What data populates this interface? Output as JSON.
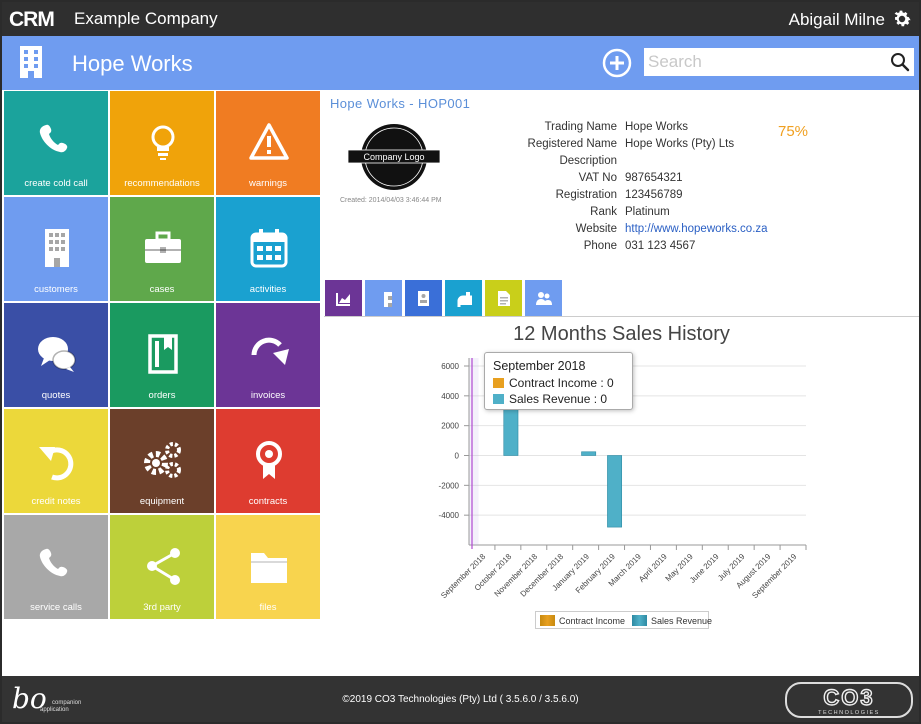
{
  "topbar": {
    "app_logo": "CRM",
    "company": "Example Company",
    "user": "Abigail Milne"
  },
  "header": {
    "title": "Hope Works",
    "search_placeholder": "Search"
  },
  "tiles": [
    {
      "label": "create cold call",
      "icon": "phone-icon",
      "color": "#1ba39c"
    },
    {
      "label": "recommendations",
      "icon": "lightbulb-icon",
      "color": "#f0a30a"
    },
    {
      "label": "warnings",
      "icon": "warning-icon",
      "color": "#f07c22"
    },
    {
      "label": "customers",
      "icon": "building-icon",
      "color": "#6f9cf0"
    },
    {
      "label": "cases",
      "icon": "briefcase-icon",
      "color": "#5fa84b"
    },
    {
      "label": "activities",
      "icon": "calendar-icon",
      "color": "#1aa1d0"
    },
    {
      "label": "quotes",
      "icon": "chat-bubbles-icon",
      "color": "#3a4fa6"
    },
    {
      "label": "orders",
      "icon": "book-icon",
      "color": "#1a9a60"
    },
    {
      "label": "invoices",
      "icon": "redo-arrow-icon",
      "color": "#6c3596"
    },
    {
      "label": "credit notes",
      "icon": "undo-arrow-icon",
      "color": "#ecd83a"
    },
    {
      "label": "equipment",
      "icon": "gears-icon",
      "color": "#6b3f2a"
    },
    {
      "label": "contracts",
      "icon": "award-ribbon-icon",
      "color": "#de3c30"
    },
    {
      "label": "service calls",
      "icon": "phone-icon",
      "color": "#a8a8a8"
    },
    {
      "label": "3rd party",
      "icon": "share-network-icon",
      "color": "#bdd03a"
    },
    {
      "label": "files",
      "icon": "folder-icon",
      "color": "#f8d44e"
    }
  ],
  "company": {
    "breadcrumb": "Hope Works - HOP001",
    "logo_text": "Company Logo",
    "created": "Created: 2014/04/03 3:46:44 PM",
    "completeness": "75%",
    "fields": [
      {
        "label": "Trading Name",
        "value": "Hope Works"
      },
      {
        "label": "Registered Name",
        "value": "Hope Works (Pty) Lts"
      },
      {
        "label": "Description",
        "value": ""
      },
      {
        "label": "VAT No",
        "value": "987654321"
      },
      {
        "label": "Registration",
        "value": "123456789"
      },
      {
        "label": "Rank",
        "value": "Platinum"
      },
      {
        "label": "Website",
        "value": "http://www.hopeworks.co.za",
        "link": true
      },
      {
        "label": "Phone",
        "value": "031 123 4567"
      }
    ]
  },
  "tabs": [
    {
      "icon": "area-chart-icon",
      "color": "#6c3596"
    },
    {
      "icon": "building-icon",
      "color": "#6f9cf0"
    },
    {
      "icon": "address-book-icon",
      "color": "#3a6fd8"
    },
    {
      "icon": "calendar-icon",
      "color": "#1aa1d0"
    },
    {
      "icon": "document-icon",
      "color": "#c9cf1a"
    },
    {
      "icon": "users-icon",
      "color": "#6f9cf0"
    }
  ],
  "chart_data": {
    "type": "bar",
    "title": "12 Months Sales History",
    "categories": [
      "September 2018",
      "October 2018",
      "November 2018",
      "December 2018",
      "January 2019",
      "February 2019",
      "March 2019",
      "April 2019",
      "May 2019",
      "June 2019",
      "July 2019",
      "August 2019",
      "September 2019"
    ],
    "series": [
      {
        "name": "Contract Income",
        "color": "#e8a020",
        "values": [
          0,
          0,
          0,
          0,
          0,
          0,
          0,
          0,
          0,
          0,
          0,
          0,
          0
        ]
      },
      {
        "name": "Sales Revenue",
        "color": "#4fb0c8",
        "values": [
          0,
          3450,
          0,
          0,
          250,
          -4800,
          0,
          0,
          0,
          0,
          0,
          0,
          0
        ]
      }
    ],
    "ylim": [
      -6000,
      6000
    ],
    "yticks": [
      "6000",
      "4000",
      "2000",
      "0",
      "-2000",
      "-4000"
    ],
    "legend": "bottom",
    "grid": true,
    "tooltip": {
      "title": "September 2018",
      "rows": [
        "Contract Income : 0",
        "Sales Revenue : 0"
      ]
    }
  },
  "footer": {
    "copyright": "©2019 CO3 Technologies (Pty) Ltd ( 3.5.6.0 / 3.5.6.0)",
    "left_logo": "a companion application",
    "right_logo": "CO3 TECHNOLOGIES"
  }
}
